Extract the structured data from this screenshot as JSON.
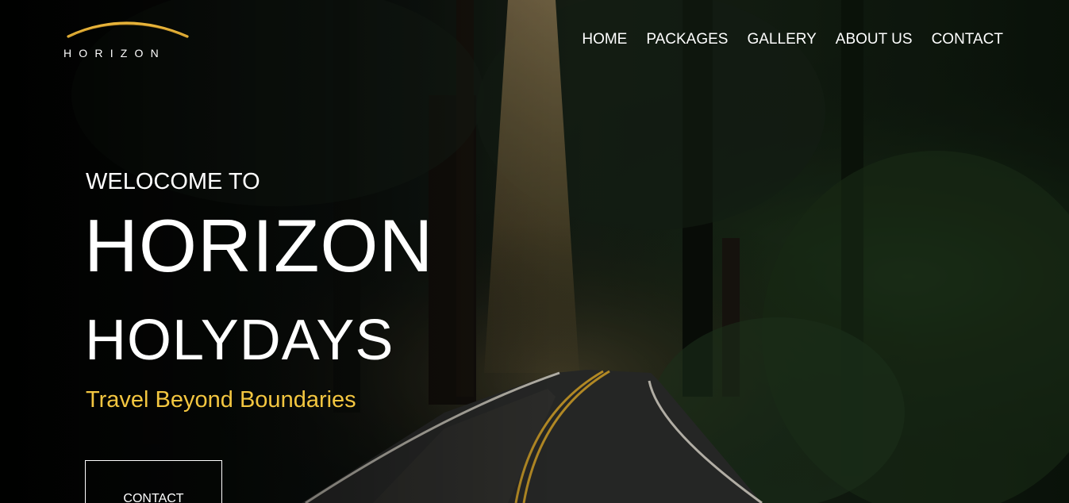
{
  "logo": {
    "text": "HORIZON",
    "arc_color": "#e8b43a"
  },
  "nav": {
    "items": [
      {
        "label": "HOME"
      },
      {
        "label": "PACKAGES"
      },
      {
        "label": "GALLERY"
      },
      {
        "label": "ABOUT US"
      },
      {
        "label": "CONTACT"
      }
    ]
  },
  "hero": {
    "welcome": "WELOCOME TO",
    "title_line_1": "HORIZON",
    "title_line_2": "HOLYDAYS",
    "tagline": "Travel Beyond Boundaries",
    "cta_label": "CONTACT",
    "background": "forest-road-photo",
    "colors": {
      "text": "#ffffff",
      "accent": "#f3c640"
    }
  }
}
